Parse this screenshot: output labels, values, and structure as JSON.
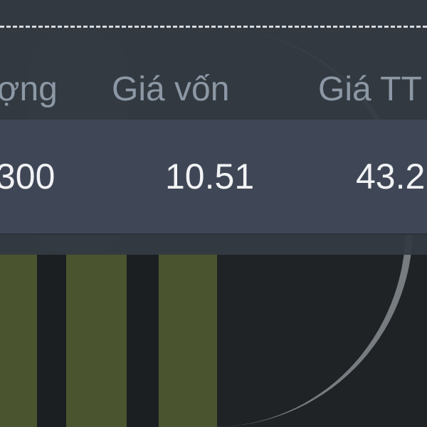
{
  "table": {
    "headers": [
      "ợng",
      "Giá vốn",
      "Giá TT"
    ],
    "rows": [
      {
        "cells": [
          "300",
          "10.51",
          "43.2"
        ]
      }
    ]
  },
  "colors": {
    "panel_bg": "#343a42",
    "row_bg": "#3f4756",
    "header_text": "#8c98a5",
    "value_text": "#f2f3f5",
    "background_bars": "#4a5530"
  }
}
